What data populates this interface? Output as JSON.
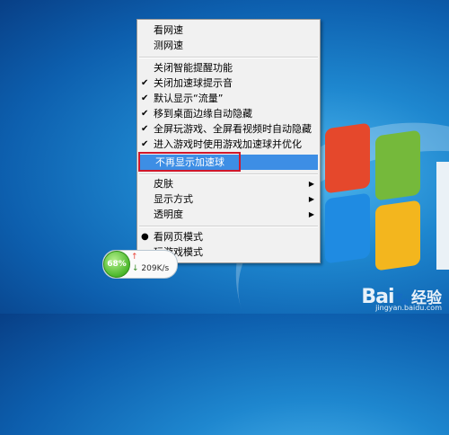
{
  "menu": {
    "items": [
      {
        "label": "看网速",
        "checked": false,
        "radio": false,
        "submenu": false
      },
      {
        "label": "测网速",
        "checked": false,
        "radio": false,
        "submenu": false
      },
      {
        "label": "关闭智能提醒功能",
        "checked": false,
        "radio": false,
        "submenu": false
      },
      {
        "label": "关闭加速球提示音",
        "checked": true,
        "radio": false,
        "submenu": false
      },
      {
        "label": "默认显示“流量”",
        "checked": true,
        "radio": false,
        "submenu": false
      },
      {
        "label": "移到桌面边缘自动隐藏",
        "checked": true,
        "radio": false,
        "submenu": false
      },
      {
        "label": "全屏玩游戏、全屏看视频时自动隐藏",
        "checked": true,
        "radio": false,
        "submenu": false
      },
      {
        "label": "进入游戏时使用游戏加速球并优化",
        "checked": true,
        "radio": false,
        "submenu": false
      },
      {
        "label": "不再显示加速球",
        "checked": false,
        "radio": false,
        "submenu": false,
        "highlighted": true
      },
      {
        "label": "皮肤",
        "checked": false,
        "radio": false,
        "submenu": true
      },
      {
        "label": "显示方式",
        "checked": false,
        "radio": false,
        "submenu": true
      },
      {
        "label": "透明度",
        "checked": false,
        "radio": false,
        "submenu": true
      },
      {
        "label": "看网页模式",
        "checked": false,
        "radio": true,
        "submenu": false
      },
      {
        "label": "玩游戏模式",
        "checked": false,
        "radio": false,
        "submenu": false
      }
    ]
  },
  "ball": {
    "percent": "68%",
    "upload": "",
    "download": "209K/s"
  },
  "watermark": {
    "logo": "Bai",
    "jingyan": "经验",
    "url": "jingyan.baidu.com"
  },
  "icons": {
    "check": "check-icon",
    "radio": "radio-dot-icon",
    "submenu": "submenu-arrow-icon"
  },
  "colors": {
    "highlight": "#3d8ee5",
    "red_box": "#d0182b",
    "ball_green": "#4cb82c"
  }
}
